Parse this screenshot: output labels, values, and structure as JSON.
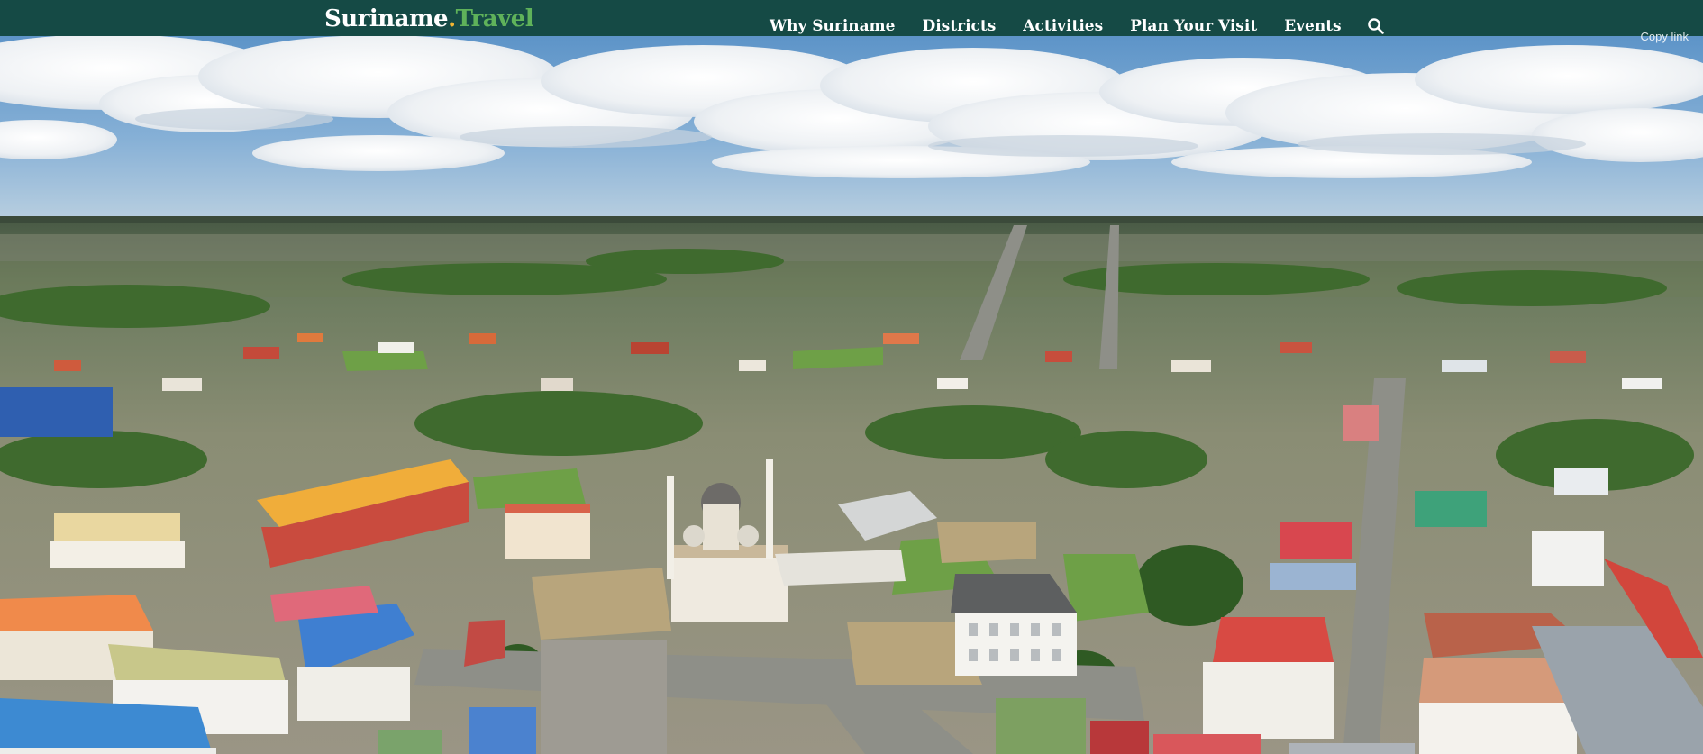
{
  "brand": {
    "part1": "Suriname",
    "dot": ".",
    "part2": "Travel",
    "color_primary": "#154a45",
    "color_accent_gold": "#f2b531",
    "color_accent_green": "#5fb25a"
  },
  "nav": {
    "items": [
      {
        "label": "Why Suriname"
      },
      {
        "label": "Districts"
      },
      {
        "label": "Activities"
      },
      {
        "label": "Plan Your Visit"
      },
      {
        "label": "Events"
      }
    ],
    "search_icon": "search-icon"
  },
  "hero": {
    "copy_link_label": "Copy link",
    "image_subject": "aerial-city-photo"
  }
}
